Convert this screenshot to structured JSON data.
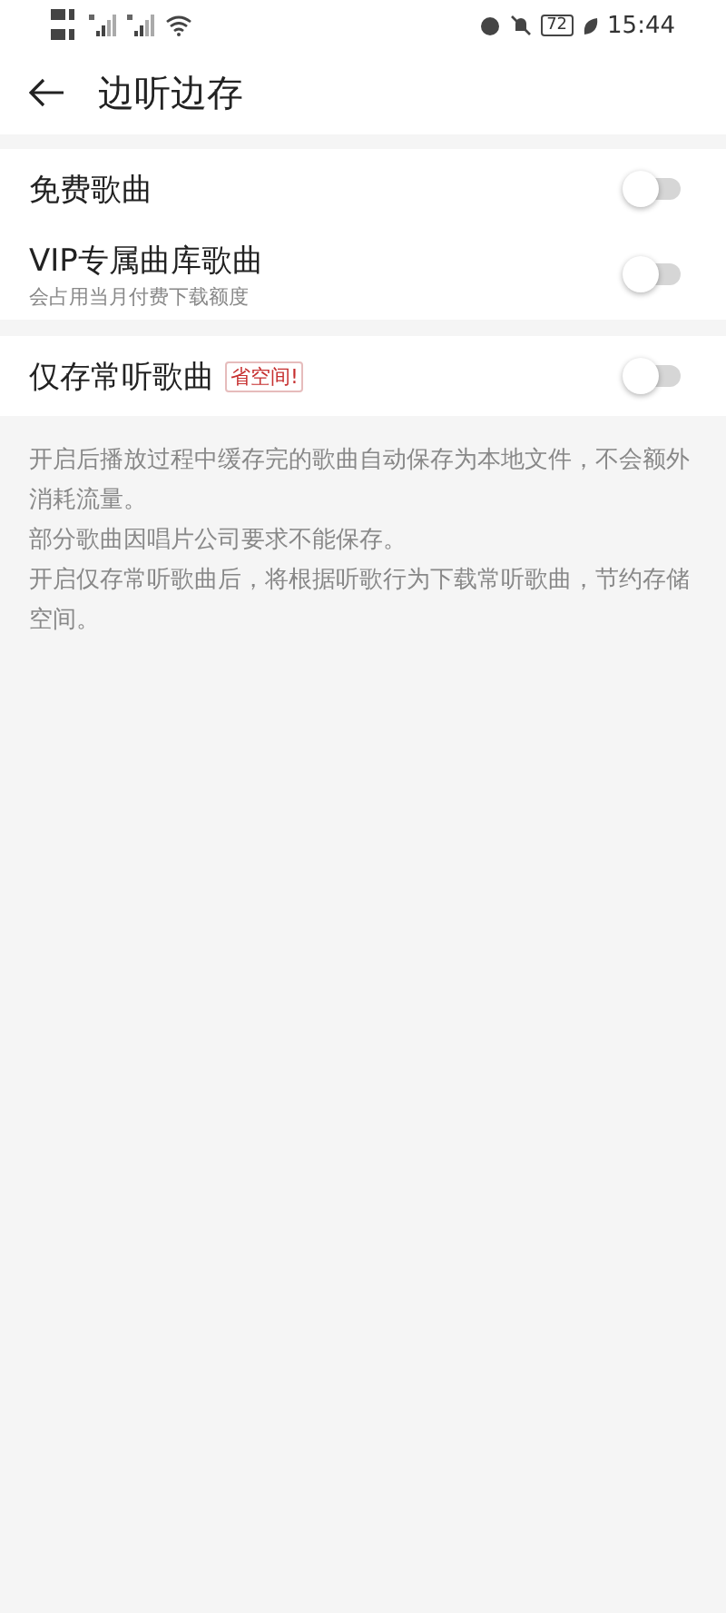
{
  "status_bar": {
    "battery": "72",
    "time": "15:44"
  },
  "header": {
    "title": "边听边存"
  },
  "sections": [
    {
      "rows": [
        {
          "label": "免费歌曲",
          "on": false
        },
        {
          "label": "VIP专属曲库歌曲",
          "subtitle": "会占用当月付费下载额度",
          "on": false
        }
      ]
    },
    {
      "rows": [
        {
          "label": "仅存常听歌曲",
          "badge": "省空间!",
          "on": false
        }
      ]
    }
  ],
  "notes": [
    "开启后播放过程中缓存完的歌曲自动保存为本地文件，不会额外消耗流量。",
    "部分歌曲因唱片公司要求不能保存。",
    "开启仅存常听歌曲后，将根据听歌行为下载常听歌曲，节约存储空间。"
  ]
}
